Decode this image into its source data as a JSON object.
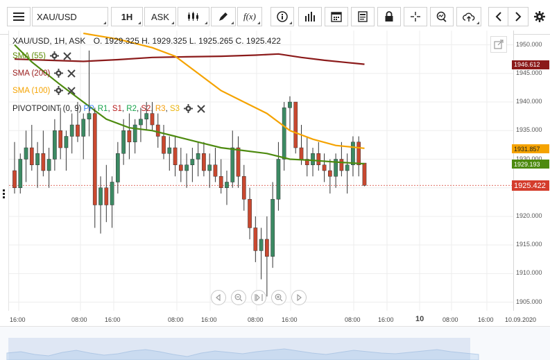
{
  "toolbar": {
    "symbol": "XAU/USD",
    "timeframe": "1H",
    "price_side": "ASK"
  },
  "legend": {
    "instrument_line": "XAU/USD, 1H, ASK",
    "ohlc": "O. 1929.325 H. 1929.325 L. 1925.265 C. 1925.422",
    "indicators": [
      {
        "label": "SMA (55)",
        "color": "#5a8a00"
      },
      {
        "label": "SMA (200)",
        "color": "#9b1c1c"
      },
      {
        "label": "SMA (100)",
        "color": "#f5a300"
      }
    ],
    "pivot": {
      "label": "PIVOTPOINT (0, 9)",
      "parts": [
        {
          "t": "PP",
          "c": "#3b82f6"
        },
        {
          "t": ", ",
          "c": "#222"
        },
        {
          "t": "R1",
          "c": "#16a34a"
        },
        {
          "t": ", ",
          "c": "#222"
        },
        {
          "t": "S1",
          "c": "#b91c1c"
        },
        {
          "t": ", ",
          "c": "#222"
        },
        {
          "t": "R2",
          "c": "#16a34a"
        },
        {
          "t": ", ",
          "c": "#222"
        },
        {
          "t": "S2",
          "c": "#b91c1c"
        },
        {
          "t": ", ",
          "c": "#222"
        },
        {
          "t": "R3",
          "c": "#f59e0b"
        },
        {
          "t": ", ",
          "c": "#222"
        },
        {
          "t": "S3",
          "c": "#eab308"
        }
      ]
    }
  },
  "price_axis": {
    "ticks": [
      "1950.000",
      "1945.000",
      "1940.000",
      "1935.000",
      "1930.000",
      "1925.000",
      "1920.000",
      "1915.000",
      "1910.000",
      "1905.000"
    ],
    "tags": [
      {
        "label": "1946.612",
        "bg": "#8b1a1a",
        "fg": "#ffffff"
      },
      {
        "label": "1931.857",
        "bg": "#f5a300",
        "fg": "#222222"
      },
      {
        "label": "1929.193",
        "bg": "#4d8a0f",
        "fg": "#ffffff"
      },
      {
        "label": "1925.422",
        "bg": "#d43c2c",
        "fg": "#ffffff"
      }
    ]
  },
  "time_axis": {
    "ticks": [
      "16:00",
      "08:00",
      "16:00",
      "08:00",
      "16:00",
      "08:00",
      "16:00",
      "08:00",
      "16:00",
      "10",
      "08:00",
      "16:00",
      "10.09.2020"
    ]
  },
  "chart_data": {
    "type": "candlestick",
    "ylim": [
      1903.5,
      1952.5
    ],
    "candles": [
      {
        "o": 1928,
        "h": 1933,
        "l": 1924,
        "c": 1925
      },
      {
        "o": 1925,
        "h": 1931,
        "l": 1924,
        "c": 1930
      },
      {
        "o": 1930,
        "h": 1935,
        "l": 1926,
        "c": 1932
      },
      {
        "o": 1932,
        "h": 1936,
        "l": 1928,
        "c": 1929
      },
      {
        "o": 1929,
        "h": 1933,
        "l": 1925,
        "c": 1931
      },
      {
        "o": 1931,
        "h": 1935,
        "l": 1927,
        "c": 1928
      },
      {
        "o": 1928,
        "h": 1932,
        "l": 1925,
        "c": 1930
      },
      {
        "o": 1930,
        "h": 1937,
        "l": 1928,
        "c": 1935
      },
      {
        "o": 1935,
        "h": 1939,
        "l": 1930,
        "c": 1932
      },
      {
        "o": 1932,
        "h": 1935,
        "l": 1928,
        "c": 1934
      },
      {
        "o": 1934,
        "h": 1938,
        "l": 1931,
        "c": 1936
      },
      {
        "o": 1936,
        "h": 1940,
        "l": 1933,
        "c": 1934
      },
      {
        "o": 1934,
        "h": 1938,
        "l": 1930,
        "c": 1937
      },
      {
        "o": 1937,
        "h": 1949,
        "l": 1934,
        "c": 1938
      },
      {
        "o": 1938,
        "h": 1939,
        "l": 1918,
        "c": 1922
      },
      {
        "o": 1922,
        "h": 1927,
        "l": 1917,
        "c": 1925
      },
      {
        "o": 1925,
        "h": 1929,
        "l": 1919,
        "c": 1922
      },
      {
        "o": 1922,
        "h": 1927,
        "l": 1918,
        "c": 1926
      },
      {
        "o": 1926,
        "h": 1933,
        "l": 1924,
        "c": 1931
      },
      {
        "o": 1931,
        "h": 1937,
        "l": 1929,
        "c": 1935
      },
      {
        "o": 1935,
        "h": 1938,
        "l": 1930,
        "c": 1933
      },
      {
        "o": 1933,
        "h": 1937,
        "l": 1931,
        "c": 1936
      },
      {
        "o": 1936,
        "h": 1939,
        "l": 1933,
        "c": 1937
      },
      {
        "o": 1937,
        "h": 1940,
        "l": 1935,
        "c": 1938
      },
      {
        "o": 1938,
        "h": 1940,
        "l": 1935,
        "c": 1936
      },
      {
        "o": 1936,
        "h": 1938,
        "l": 1932,
        "c": 1934
      },
      {
        "o": 1934,
        "h": 1936,
        "l": 1930,
        "c": 1931
      },
      {
        "o": 1931,
        "h": 1934,
        "l": 1928,
        "c": 1932
      },
      {
        "o": 1932,
        "h": 1934,
        "l": 1927,
        "c": 1929
      },
      {
        "o": 1929,
        "h": 1932,
        "l": 1926,
        "c": 1928
      },
      {
        "o": 1928,
        "h": 1931,
        "l": 1925,
        "c": 1929
      },
      {
        "o": 1929,
        "h": 1932,
        "l": 1926,
        "c": 1930
      },
      {
        "o": 1930,
        "h": 1933,
        "l": 1927,
        "c": 1931
      },
      {
        "o": 1931,
        "h": 1933,
        "l": 1927,
        "c": 1928
      },
      {
        "o": 1928,
        "h": 1931,
        "l": 1925,
        "c": 1929
      },
      {
        "o": 1929,
        "h": 1932,
        "l": 1926,
        "c": 1927
      },
      {
        "o": 1927,
        "h": 1930,
        "l": 1924,
        "c": 1925
      },
      {
        "o": 1925,
        "h": 1928,
        "l": 1922,
        "c": 1926
      },
      {
        "o": 1926,
        "h": 1935,
        "l": 1925,
        "c": 1932
      },
      {
        "o": 1932,
        "h": 1934,
        "l": 1925,
        "c": 1927
      },
      {
        "o": 1927,
        "h": 1929,
        "l": 1921,
        "c": 1923
      },
      {
        "o": 1923,
        "h": 1925,
        "l": 1916,
        "c": 1918
      },
      {
        "o": 1918,
        "h": 1920,
        "l": 1912,
        "c": 1914
      },
      {
        "o": 1914,
        "h": 1918,
        "l": 1909,
        "c": 1916
      },
      {
        "o": 1916,
        "h": 1920,
        "l": 1906,
        "c": 1913
      },
      {
        "o": 1913,
        "h": 1926,
        "l": 1911,
        "c": 1923
      },
      {
        "o": 1923,
        "h": 1933,
        "l": 1921,
        "c": 1930
      },
      {
        "o": 1930,
        "h": 1940,
        "l": 1928,
        "c": 1939
      },
      {
        "o": 1939,
        "h": 1941,
        "l": 1935,
        "c": 1940
      },
      {
        "o": 1940,
        "h": 1940,
        "l": 1931,
        "c": 1932
      },
      {
        "o": 1932,
        "h": 1936,
        "l": 1929,
        "c": 1930
      },
      {
        "o": 1930,
        "h": 1934,
        "l": 1927,
        "c": 1929
      },
      {
        "o": 1929,
        "h": 1932,
        "l": 1927,
        "c": 1931
      },
      {
        "o": 1931,
        "h": 1933,
        "l": 1928,
        "c": 1929
      },
      {
        "o": 1929,
        "h": 1931,
        "l": 1926,
        "c": 1928
      },
      {
        "o": 1928,
        "h": 1930,
        "l": 1924,
        "c": 1927
      },
      {
        "o": 1927,
        "h": 1931,
        "l": 1925,
        "c": 1930
      },
      {
        "o": 1930,
        "h": 1933,
        "l": 1927,
        "c": 1928
      },
      {
        "o": 1928,
        "h": 1931,
        "l": 1924,
        "c": 1929
      },
      {
        "o": 1929,
        "h": 1934,
        "l": 1927,
        "c": 1933
      },
      {
        "o": 1933,
        "h": 1934,
        "l": 1927,
        "c": 1929
      },
      {
        "o": 1929.325,
        "h": 1929.325,
        "l": 1925.265,
        "c": 1925.422
      }
    ],
    "sma55": [
      [
        0,
        1950
      ],
      [
        3,
        1947
      ],
      [
        8,
        1943
      ],
      [
        12,
        1940
      ],
      [
        16,
        1937
      ],
      [
        20,
        1935.5
      ],
      [
        24,
        1935
      ],
      [
        28,
        1934
      ],
      [
        32,
        1933
      ],
      [
        36,
        1932
      ],
      [
        40,
        1931.5
      ],
      [
        44,
        1931
      ],
      [
        48,
        1930
      ],
      [
        52,
        1929.8
      ],
      [
        56,
        1929.5
      ],
      [
        61,
        1929.2
      ]
    ],
    "sma200": [
      [
        0,
        1947.5
      ],
      [
        6,
        1947.3
      ],
      [
        12,
        1947.1
      ],
      [
        18,
        1947.4
      ],
      [
        24,
        1947.8
      ],
      [
        30,
        1947.9
      ],
      [
        36,
        1948
      ],
      [
        42,
        1948.2
      ],
      [
        46,
        1948.4
      ],
      [
        50,
        1947.8
      ],
      [
        54,
        1947.3
      ],
      [
        58,
        1946.9
      ],
      [
        61,
        1946.6
      ]
    ],
    "sma100": [
      [
        12,
        1952
      ],
      [
        18,
        1951
      ],
      [
        24,
        1949.5
      ],
      [
        28,
        1948
      ],
      [
        32,
        1945
      ],
      [
        36,
        1942
      ],
      [
        40,
        1940
      ],
      [
        44,
        1938
      ],
      [
        48,
        1935
      ],
      [
        52,
        1933.5
      ],
      [
        56,
        1932.4
      ],
      [
        61,
        1931.9
      ]
    ]
  }
}
